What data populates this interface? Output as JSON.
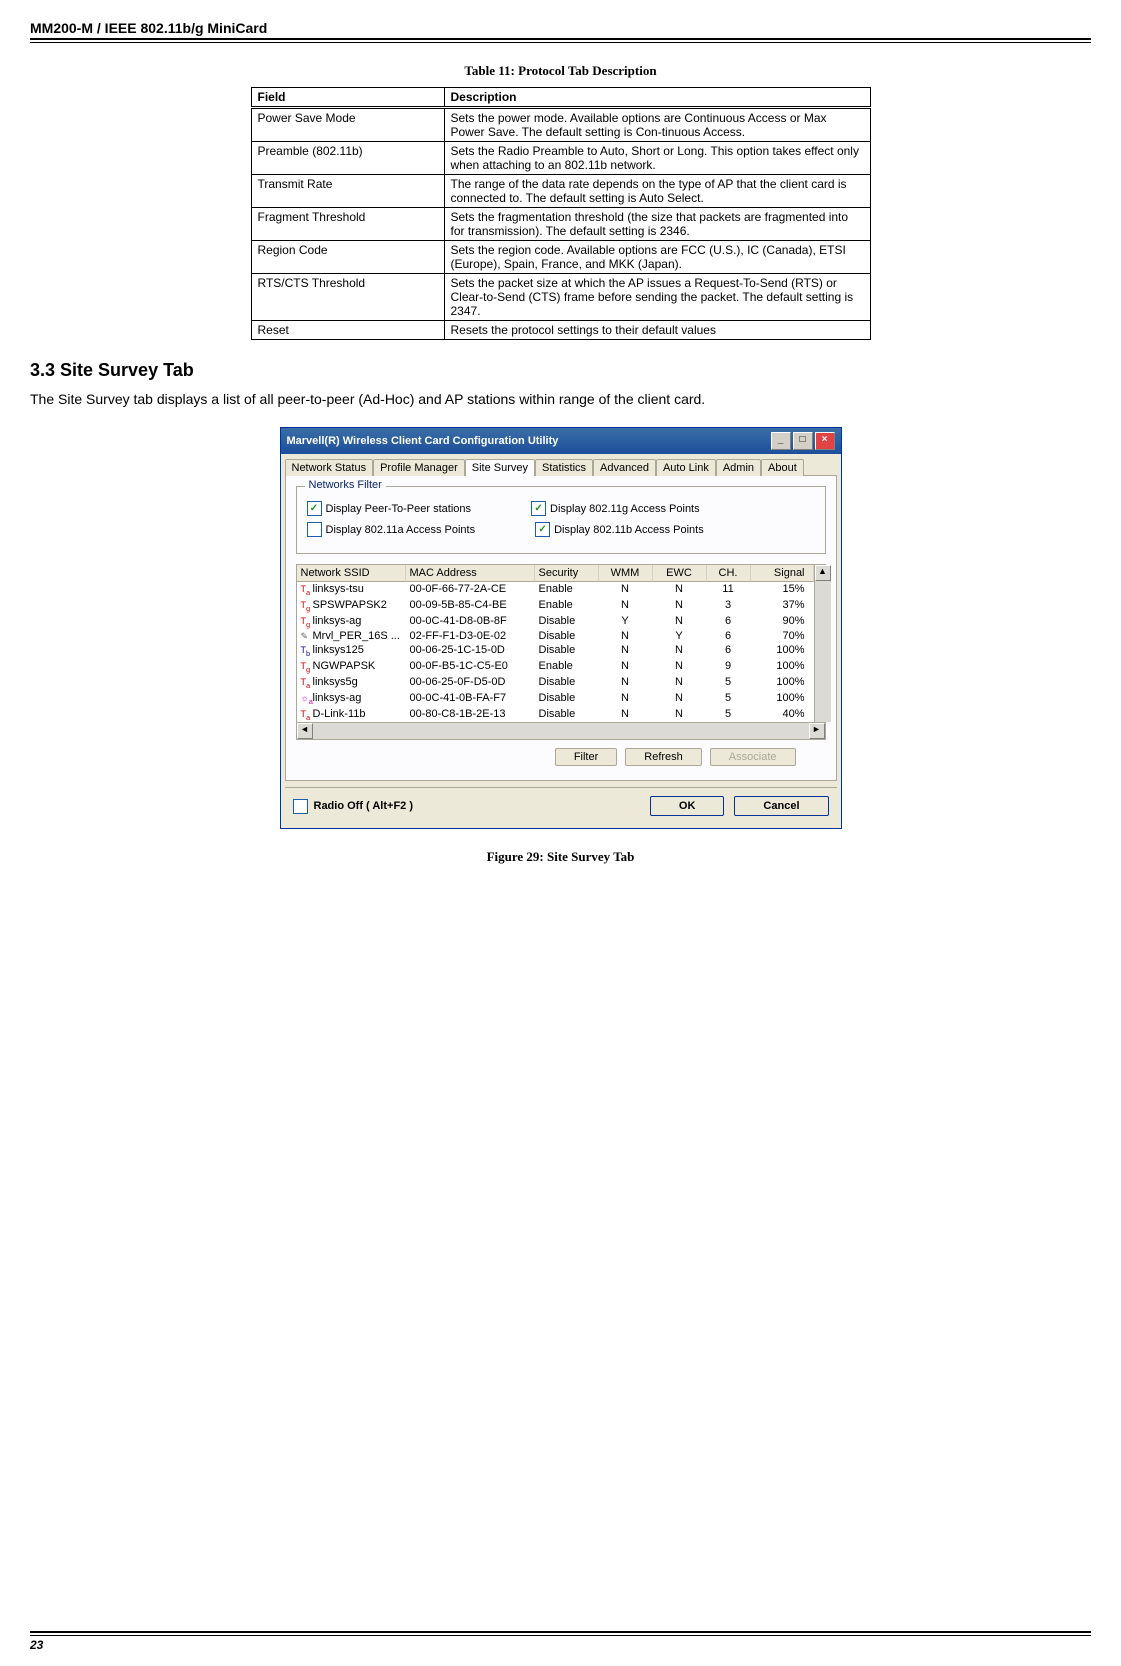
{
  "doc_header": "MM200-M / IEEE 802.11b/g MiniCard",
  "table_caption": "Table 11: Protocol Tab Description",
  "table_head": {
    "field": "Field",
    "desc": "Description"
  },
  "table_rows": [
    {
      "field": "Power Save Mode",
      "desc": "Sets the power mode. Available options are Continuous Access or Max Power Save. The default setting is Con-tinuous Access."
    },
    {
      "field": "Preamble (802.11b)",
      "desc": "Sets the Radio Preamble to Auto, Short or Long. This option takes effect only when attaching to an 802.11b network."
    },
    {
      "field": "Transmit Rate",
      "desc": "The range of the data rate depends on the type of AP that the client card is connected to. The default setting is Auto Select."
    },
    {
      "field": "Fragment Threshold",
      "desc": "Sets the fragmentation threshold (the size that packets are fragmented into for transmission). The default setting is 2346."
    },
    {
      "field": "Region Code",
      "desc": "Sets the region code. Available options are FCC (U.S.), IC (Canada), ETSI (Europe), Spain, France, and MKK (Japan)."
    },
    {
      "field": "RTS/CTS Threshold",
      "desc": "Sets the packet size at which the AP issues a Request-To-Send (RTS) or Clear-to-Send (CTS) frame before sending the packet. The default setting is 2347."
    },
    {
      "field": "Reset",
      "desc": "Resets the protocol settings to their default values"
    }
  ],
  "section_heading": "3.3 Site Survey Tab",
  "body_text": "The Site Survey tab displays a list of all peer-to-peer (Ad-Hoc) and AP stations within range of the client card.",
  "app": {
    "title": "Marvell(R) Wireless Client Card Configuration Utility",
    "tabs": [
      "Network Status",
      "Profile Manager",
      "Site Survey",
      "Statistics",
      "Advanced",
      "Auto Link",
      "Admin",
      "About"
    ],
    "active_tab": "Site Survey",
    "filter_legend": "Networks Filter",
    "chk1": "Display Peer-To-Peer stations",
    "chk2": "Display 802.11g Access Points",
    "chk3": "Display 802.11a Access Points",
    "chk4": "Display 802.11b Access Points",
    "cols": {
      "ssid": "Network SSID",
      "mac": "MAC Address",
      "sec": "Security",
      "wmm": "WMM",
      "ewc": "EWC",
      "ch": "CH.",
      "sig": "Signal"
    },
    "rows": [
      {
        "ico": "a",
        "ssid": "linksys-tsu",
        "mac": "00-0F-66-77-2A-CE",
        "sec": "Enable",
        "wmm": "N",
        "ewc": "N",
        "ch": "11",
        "sig": "15%"
      },
      {
        "ico": "g",
        "ssid": "SPSWPAPSK2",
        "mac": "00-09-5B-85-C4-BE",
        "sec": "Enable",
        "wmm": "N",
        "ewc": "N",
        "ch": "3",
        "sig": "37%"
      },
      {
        "ico": "g",
        "ssid": "linksys-ag",
        "mac": "00-0C-41-D8-0B-8F",
        "sec": "Disable",
        "wmm": "Y",
        "ewc": "N",
        "ch": "6",
        "sig": "90%"
      },
      {
        "ico": "n",
        "ssid": "Mrvl_PER_16S ...",
        "mac": "02-FF-F1-D3-0E-02",
        "sec": "Disable",
        "wmm": "N",
        "ewc": "Y",
        "ch": "6",
        "sig": "70%"
      },
      {
        "ico": "b",
        "ssid": "linksys125",
        "mac": "00-06-25-1C-15-0D",
        "sec": "Disable",
        "wmm": "N",
        "ewc": "N",
        "ch": "6",
        "sig": "100%"
      },
      {
        "ico": "g",
        "ssid": "NGWPAPSK",
        "mac": "00-0F-B5-1C-C5-E0",
        "sec": "Enable",
        "wmm": "N",
        "ewc": "N",
        "ch": "9",
        "sig": "100%"
      },
      {
        "ico": "a",
        "ssid": "linksys5g",
        "mac": "00-06-25-0F-D5-0D",
        "sec": "Disable",
        "wmm": "N",
        "ewc": "N",
        "ch": "5",
        "sig": "100%"
      },
      {
        "ico": "pa",
        "ssid": "linksys-ag",
        "mac": "00-0C-41-0B-FA-F7",
        "sec": "Disable",
        "wmm": "N",
        "ewc": "N",
        "ch": "5",
        "sig": "100%"
      },
      {
        "ico": "a",
        "ssid": "D-Link-11b",
        "mac": "00-80-C8-1B-2E-13",
        "sec": "Disable",
        "wmm": "N",
        "ewc": "N",
        "ch": "5",
        "sig": "40%"
      }
    ],
    "btn_filter": "Filter",
    "btn_refresh": "Refresh",
    "btn_assoc": "Associate",
    "radio_off": "Radio Off  ( Alt+F2 )",
    "btn_ok": "OK",
    "btn_cancel": "Cancel"
  },
  "fig_caption": "Figure 29: Site Survey Tab",
  "page_num": "23"
}
